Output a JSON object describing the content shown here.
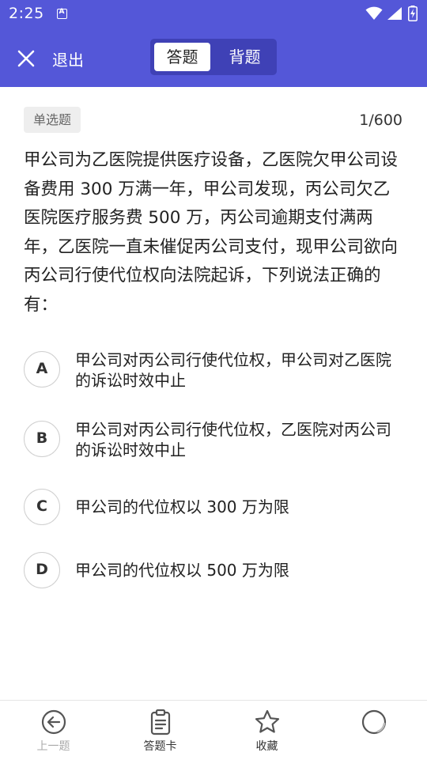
{
  "status_bar": {
    "time": "2:25",
    "notification_glyph": "A"
  },
  "header": {
    "exit_label": "退出",
    "mode_tabs": [
      {
        "label": "答题",
        "active": true
      },
      {
        "label": "背题",
        "active": false
      }
    ]
  },
  "question": {
    "type_badge": "单选题",
    "progress": "1/600",
    "text": "甲公司为乙医院提供医疗设备，乙医院欠甲公司设备费用 300 万满一年，甲公司发现，丙公司欠乙医院医疗服务费 500 万，丙公司逾期支付满两年，乙医院一直未催促丙公司支付，现甲公司欲向丙公司行使代位权向法院起诉，下列说法正确的有：",
    "options": [
      {
        "letter": "A",
        "text": "甲公司对丙公司行使代位权，甲公司对乙医院的诉讼时效中止"
      },
      {
        "letter": "B",
        "text": "甲公司对丙公司行使代位权，乙医院对丙公司的诉讼时效中止"
      },
      {
        "letter": "C",
        "text": "甲公司的代位权以 300 万为限"
      },
      {
        "letter": "D",
        "text": "甲公司的代位权以 500 万为限"
      }
    ]
  },
  "bottom_nav": {
    "items": [
      {
        "label": "上一题",
        "icon": "arrow-left-circle-icon",
        "enabled": false
      },
      {
        "label": "答题卡",
        "icon": "clipboard-icon",
        "enabled": true
      },
      {
        "label": "收藏",
        "icon": "star-icon",
        "enabled": true
      },
      {
        "label": "",
        "icon": "loading-circle-icon",
        "enabled": true
      }
    ]
  },
  "colors": {
    "primary": "#5457d8",
    "toggle_bg": "#3f41b6",
    "badge_bg": "#eeeeee",
    "disabled_text": "#aaaaaa"
  }
}
